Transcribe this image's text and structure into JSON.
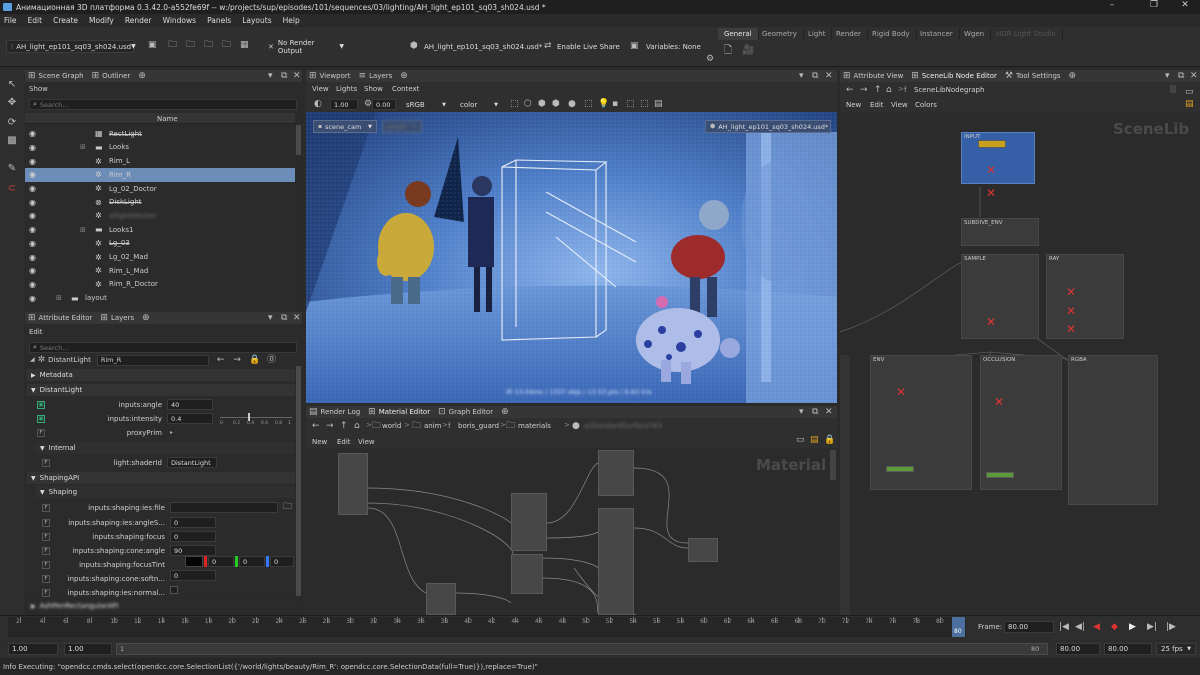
{
  "window": {
    "title": "Анимационная 3D платформа 0.3.42.0-a552fe69f -- w:/projects/sup/episodes/101/sequences/03/lighting/AH_light_ep101_sq03_sh024.usd *",
    "controls": [
      "–",
      "❐",
      "✕"
    ]
  },
  "menu": [
    "File",
    "Edit",
    "Create",
    "Modify",
    "Render",
    "Windows",
    "Panels",
    "Layouts",
    "Help"
  ],
  "toolbar": {
    "file_combo": "AH_light_ep101_sq03_sh024.usd",
    "render_output": "No Render Output",
    "current_file": "AH_light_ep101_sq03_sh024.usd*",
    "live_share": "Enable Live Share",
    "variables": "Variables: None",
    "shelf_tabs": [
      "General",
      "Geometry",
      "Light",
      "Render",
      "Rigid Body",
      "Instancer",
      "Wgen",
      "HDR Light Studio"
    ],
    "active_shelf": "General"
  },
  "outliner": {
    "tabs": [
      "Scene Graph",
      "Outliner"
    ],
    "show_label": "Show",
    "search_placeholder": "Search...",
    "column_name": "Name",
    "rows": [
      {
        "label": "RectLight",
        "icon": "grid",
        "strike": true,
        "blur": false,
        "indent": 1,
        "selected": false
      },
      {
        "label": "Looks",
        "icon": "folder",
        "strike": false,
        "blur": false,
        "indent": 1,
        "selected": false,
        "expander": true
      },
      {
        "label": "Rim_L",
        "icon": "light",
        "strike": false,
        "blur": false,
        "indent": 1,
        "selected": false
      },
      {
        "label": "Rim_R",
        "icon": "light",
        "strike": false,
        "blur": false,
        "indent": 1,
        "selected": true
      },
      {
        "label": "Lg_02_Doctor",
        "icon": "light",
        "strike": false,
        "blur": false,
        "indent": 1,
        "selected": false
      },
      {
        "label": "DiskLight",
        "icon": "disk",
        "strike": true,
        "blur": false,
        "indent": 1,
        "selected": false
      },
      {
        "label": "allightblocker",
        "icon": "light",
        "strike": false,
        "blur": true,
        "indent": 1,
        "selected": false
      },
      {
        "label": "Looks1",
        "icon": "folder",
        "strike": false,
        "blur": false,
        "indent": 1,
        "selected": false,
        "expander": true
      },
      {
        "label": "Lg_03",
        "icon": "light",
        "strike": true,
        "blur": false,
        "indent": 1,
        "selected": false
      },
      {
        "label": "Lg_02_Mad",
        "icon": "light",
        "strike": false,
        "blur": false,
        "indent": 1,
        "selected": false
      },
      {
        "label": "Rim_L_Mad",
        "icon": "light",
        "strike": false,
        "blur": false,
        "indent": 1,
        "selected": false
      },
      {
        "label": "Rim_R_Doctor",
        "icon": "light",
        "strike": false,
        "blur": false,
        "indent": 1,
        "selected": false
      },
      {
        "label": "layout",
        "icon": "folder",
        "strike": false,
        "blur": false,
        "indent": 0,
        "selected": false,
        "expander": true
      }
    ]
  },
  "attribute_editor": {
    "tabs": [
      "Attribute Editor",
      "Layers"
    ],
    "edit_menu": "Edit",
    "search_placeholder": "Search...",
    "prim_type": "DistantLight",
    "prim_name": "Rim_R",
    "sections": {
      "metadata": "Metadata",
      "distant_light": "DistantLight",
      "internal": "Internal",
      "shaping_api": "ShapingAPI",
      "shaping": "Shaping",
      "collapsed_api": "AshPenRectangularAPI"
    },
    "attrs": {
      "angle_label": "inputs:angle",
      "angle_value": "40",
      "intensity_label": "inputs:intensity",
      "intensity_value": "0.4",
      "slider_ticks": [
        "0",
        "0.2",
        "0.4",
        "0.6",
        "0.8",
        "1"
      ],
      "proxy_label": "proxyPrim",
      "shader_label": "light:shaderId",
      "shader_value": "DistantLight",
      "ies_file_label": "inputs:shaping:ies:file",
      "ies_angle_label": "inputs:shaping:ies:angleS...",
      "ies_angle_value": "0",
      "focus_label": "inputs:shaping:focus",
      "focus_value": "0",
      "cone_angle_label": "inputs:shaping:cone:angle",
      "cone_angle_value": "90",
      "focus_tint_label": "inputs:shaping:focusTint",
      "tint_r": "0",
      "tint_g": "0",
      "tint_b": "0",
      "cone_soft_label": "inputs:shaping:cone:softn...",
      "cone_soft_value": "0",
      "ies_norm_label": "inputs:shaping:ies:normal..."
    }
  },
  "viewport": {
    "tabs": [
      "Viewport",
      "Layers"
    ],
    "menu": [
      "View",
      "Lights",
      "Show",
      "Context"
    ],
    "exposure": "1.00",
    "gamma": "0.00",
    "colorspace": "sRGB",
    "channel": "color",
    "camera": "scene_cam",
    "blur_tag": "email",
    "shot_badge": "AH_light_ep101_sq03_sh024.usd*",
    "stats_overlay": "ift 13.04ms / 1337 objs / 13.53 pts / 6.63 tris"
  },
  "material_editor": {
    "tabs": [
      "Render Log",
      "Material Editor",
      "Graph Editor"
    ],
    "breadcrumb": [
      "world",
      "anim",
      "boris_guard",
      "materials",
      "aiStandardSurface763"
    ],
    "menu": [
      "New",
      "Edit",
      "View"
    ],
    "watermark": "Material"
  },
  "node_editor": {
    "tabs": [
      "Attribute View",
      "SceneLib Node Editor",
      "Tool Settings"
    ],
    "path": "SceneLibNodegraph",
    "menu": [
      "New",
      "Edit",
      "View",
      "Colors"
    ],
    "watermark": "SceneLib",
    "groups": [
      "INPUT",
      "SUBDIVE_ENV",
      "SAMPLE",
      "RAY",
      "ENV",
      "OCCLUSION",
      "RGBA"
    ]
  },
  "timeline": {
    "ticks": [
      "2",
      "4",
      "6",
      "8",
      "10",
      "12",
      "14",
      "16",
      "18",
      "20",
      "22",
      "24",
      "26",
      "28",
      "30",
      "32",
      "34",
      "36",
      "38",
      "40",
      "42",
      "44",
      "46",
      "48",
      "50",
      "52",
      "54",
      "56",
      "58",
      "60",
      "62",
      "64",
      "66",
      "68",
      "70",
      "72",
      "74",
      "76",
      "78",
      "80"
    ],
    "current_frame_label": "Frame:",
    "current_frame": "80.00",
    "current_marker": "80",
    "range_start": "1.00",
    "range_inner_start": "1.00",
    "range_slider_start": "1",
    "range_slider_end": "80",
    "range_end": "80.00",
    "range_end2": "80.00",
    "fps": "25 fps",
    "playback_icons": [
      "|◀",
      "◀|",
      "◀",
      "▶",
      "▶|",
      "|▶"
    ]
  },
  "status": "Info Executing: \"opendcc.cmds.select(opendcc.core.SelectionList({'/world/lights/beauty/Rim_R': opendcc.core.SelectionData(full=True)}),replace=True)\"",
  "colors": {
    "accent_blue": "#5b7fb5",
    "viewport_blue": "#3f6fc4",
    "selected_row": "#6b8db8"
  }
}
